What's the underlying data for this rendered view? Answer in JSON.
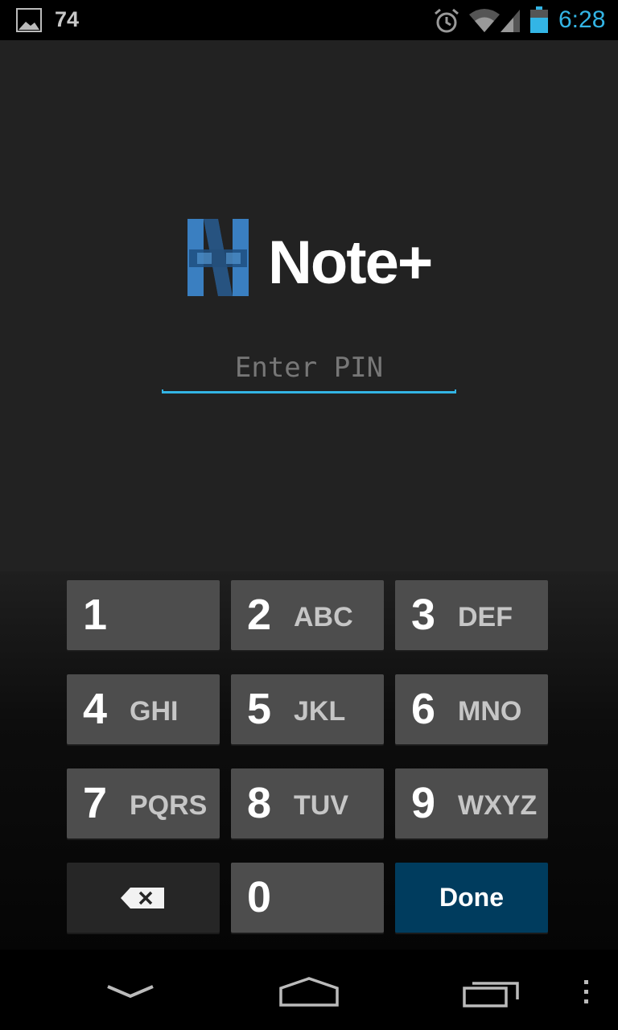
{
  "status_bar": {
    "notification_count": "74",
    "clock": "6:28",
    "icons": [
      "gallery-icon",
      "alarm-icon",
      "wifi-icon",
      "signal-icon",
      "battery-icon"
    ]
  },
  "app": {
    "title": "Note+",
    "logo_icon": "note-plus-logo",
    "pin_placeholder": "Enter PIN",
    "pin_value": ""
  },
  "keypad": {
    "keys": [
      {
        "digit": "1",
        "letters": ""
      },
      {
        "digit": "2",
        "letters": "ABC"
      },
      {
        "digit": "3",
        "letters": "DEF"
      },
      {
        "digit": "4",
        "letters": "GHI"
      },
      {
        "digit": "5",
        "letters": "JKL"
      },
      {
        "digit": "6",
        "letters": "MNO"
      },
      {
        "digit": "7",
        "letters": "PQRS"
      },
      {
        "digit": "8",
        "letters": "TUV"
      },
      {
        "digit": "9",
        "letters": "WXYZ"
      },
      {
        "digit": "0",
        "letters": ""
      }
    ],
    "backspace_icon": "backspace-icon",
    "done_label": "Done"
  },
  "nav_bar": {
    "icons": [
      "back-icon",
      "home-icon",
      "recents-icon",
      "menu-icon"
    ]
  },
  "colors": {
    "accent": "#33b5e5",
    "app_background": "#222222",
    "key_background": "#4d4d4d",
    "done_background": "#003c5e"
  }
}
